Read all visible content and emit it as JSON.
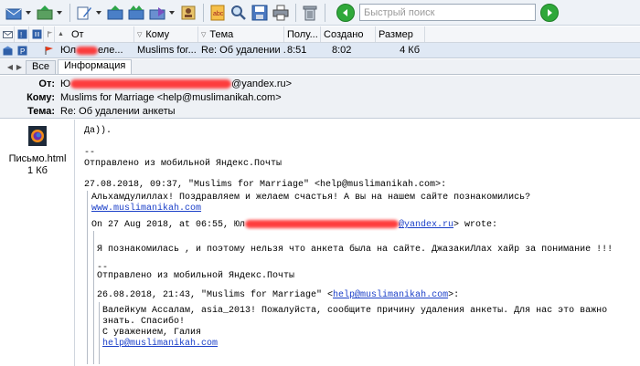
{
  "toolbar": {
    "search_placeholder": "Быстрый поиск",
    "buttons": [
      {
        "icon": "receive-mail-icon",
        "dropdown": true
      },
      {
        "icon": "send-mail-icon",
        "dropdown": true
      },
      {
        "icon": "new-message-icon",
        "dropdown": true
      },
      {
        "icon": "reply-icon"
      },
      {
        "icon": "reply-all-icon"
      },
      {
        "icon": "forward-icon",
        "dropdown": true
      },
      {
        "icon": "address-book-icon"
      },
      {
        "icon": "spellcheck-icon"
      },
      {
        "icon": "find-icon"
      },
      {
        "icon": "save-icon"
      },
      {
        "icon": "print-icon"
      },
      {
        "icon": "delete-icon"
      }
    ]
  },
  "list": {
    "columns": {
      "from": "От",
      "to": "Кому",
      "subject": "Тема",
      "received": "Полу...",
      "created": "Создано",
      "size": "Размер"
    },
    "row": {
      "from": "Юл",
      "from_tail": "еле...",
      "to": "Muslims for...",
      "subject": "Re: Об удалении ...",
      "received": "8:51",
      "created": "8:02",
      "size": "4 Кб"
    }
  },
  "tabs": {
    "all": "Все",
    "info": "Информация"
  },
  "header": {
    "from_label": "От:",
    "from_value_start": "Ю",
    "from_value_end": "@yandex.ru>",
    "to_label": "Кому:",
    "to_value": "Muslims for Marriage <help@muslimanikah.com>",
    "subject_label": "Тема:",
    "subject_value": "Re: Об удалении анкеты"
  },
  "attachment": {
    "name": "Письмо.html",
    "size": "1 Кб"
  },
  "body": {
    "l1": "Да)).",
    "l2": "--",
    "l3": "Отправлено из мобильной Яндекс.Почты",
    "l4": "27.08.2018, 09:37, \"Muslims for Marriage\" <help@muslimanikah.com>:",
    "l5": "Альхамдулиллах! Поздравляем и желаем счастья! А вы на нашем сайте познакомились?",
    "l6": "www.muslimanikah.com",
    "l7_start": "On 27 Aug 2018, at 06:55, Юл",
    "l7_link": "@yandex.ru",
    "l7_end": "> wrote:",
    "l8": "Я познакомилась , и поэтому нельзя что анкета была на сайте. ДжазакиЛлах хайр за понимание !!!",
    "l9": "--",
    "l10": "Отправлено из мобильной Яндекс.Почты",
    "l11_start": "26.08.2018, 21:43, \"Muslims for Marriage\" <",
    "l11_link": "help@muslimanikah.com",
    "l11_end": ">:",
    "l12": "Валейкум Ассалам, asia_2013! Пожалуйста, сообщите причину удаления анкеты. Для нас это важно",
    "l13": "знать. Спасибо!",
    "l14": "С уважением, Галия",
    "l15": "help@muslimanikah.com"
  }
}
